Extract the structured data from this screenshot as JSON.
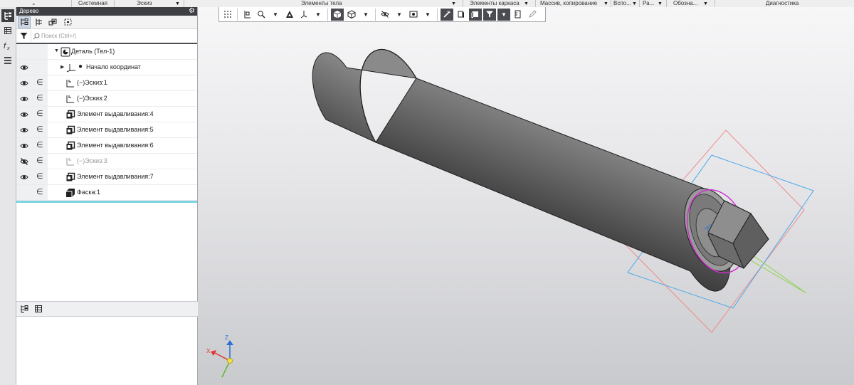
{
  "ribbon": {
    "groups": [
      "Системная",
      "Эскиз",
      "Элементы тела",
      "Элементы каркаса",
      "Массив, копирование",
      "Вспо...",
      "Ра...",
      "Обозна...",
      "Диагностика"
    ]
  },
  "panel": {
    "title": "Дерево",
    "search_placeholder": "Поиск (Ctrl+/)"
  },
  "tree": {
    "root": "Деталь (Тел-1)",
    "origin": "Начало координат",
    "items": [
      {
        "label": "Эскиз:1",
        "kind": "sketch",
        "visible": true
      },
      {
        "label": "Эскиз:2",
        "kind": "sketch",
        "visible": true
      },
      {
        "label": "Элемент выдавливания:4",
        "kind": "extrude",
        "visible": true
      },
      {
        "label": "Элемент выдавливания:5",
        "kind": "extrude",
        "visible": true
      },
      {
        "label": "Элемент выдавливания:6",
        "kind": "extrude",
        "visible": true
      },
      {
        "label": "Эскиз:3",
        "kind": "sketch",
        "visible": false
      },
      {
        "label": "Элемент выдавливания:7",
        "kind": "extrude",
        "visible": true
      },
      {
        "label": "Фаска:1",
        "kind": "chamfer",
        "visible": null
      }
    ]
  },
  "axes": {
    "x": "X",
    "y": "Y",
    "z": "Z"
  },
  "colors": {
    "accent": "#7fd3e3",
    "title_bar": "#3d3f43",
    "plane_red": "#f08a8a",
    "plane_blue": "#4aa8e8",
    "plane_green": "#8fd14f",
    "selection": "#d22ad2"
  }
}
